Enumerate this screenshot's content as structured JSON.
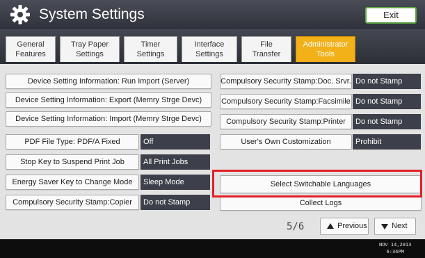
{
  "title": "System Settings",
  "exit_label": "Exit",
  "tabs": [
    {
      "label": "General\nFeatures",
      "active": false
    },
    {
      "label": "Tray Paper\nSettings",
      "active": false
    },
    {
      "label": "Timer\nSettings",
      "active": false
    },
    {
      "label": "Interface\nSettings",
      "active": false
    },
    {
      "label": "File\nTransfer",
      "active": false
    },
    {
      "label": "Administrator\nTools",
      "active": true
    }
  ],
  "left": [
    {
      "label": "Device Setting Information: Run Import (Server)",
      "value": ""
    },
    {
      "label": "Device Setting Information: Export (Memry Strge Devc)",
      "value": ""
    },
    {
      "label": "Device Setting Information: Import (Memry Strge Devc)",
      "value": ""
    },
    {
      "label": "PDF File Type: PDF/A Fixed",
      "value": "Off"
    },
    {
      "label": "Stop Key to Suspend Print Job",
      "value": "All Print Jobs"
    },
    {
      "label": "Energy Saver Key to Change Mode",
      "value": "Sleep Mode"
    },
    {
      "label": "Compulsory Security Stamp:Copier",
      "value": "Do not Stamp"
    }
  ],
  "right": [
    {
      "label": "Compulsory Security Stamp:Doc. Srvr.",
      "value": "Do not Stamp"
    },
    {
      "label": "Compulsory Security Stamp:Facsimile",
      "value": "Do not Stamp"
    },
    {
      "label": "Compulsory Security Stamp:Printer",
      "value": "Do not Stamp"
    },
    {
      "label": "User's Own Customization",
      "value": "Prohibit"
    },
    {
      "label": "Select Switchable Languages",
      "value": ""
    },
    {
      "label": "Collect Logs",
      "value": ""
    }
  ],
  "pager": {
    "indicator": "5/6",
    "previous": "Previous",
    "next": "Next"
  },
  "datetime": {
    "date": "NOV  14,2013",
    "time": "6:34PM"
  },
  "colors": {
    "accent_tab": "#f2b019",
    "highlight": "#e61e26",
    "value_bg": "#3d404a",
    "exit_border": "#5fa846"
  }
}
